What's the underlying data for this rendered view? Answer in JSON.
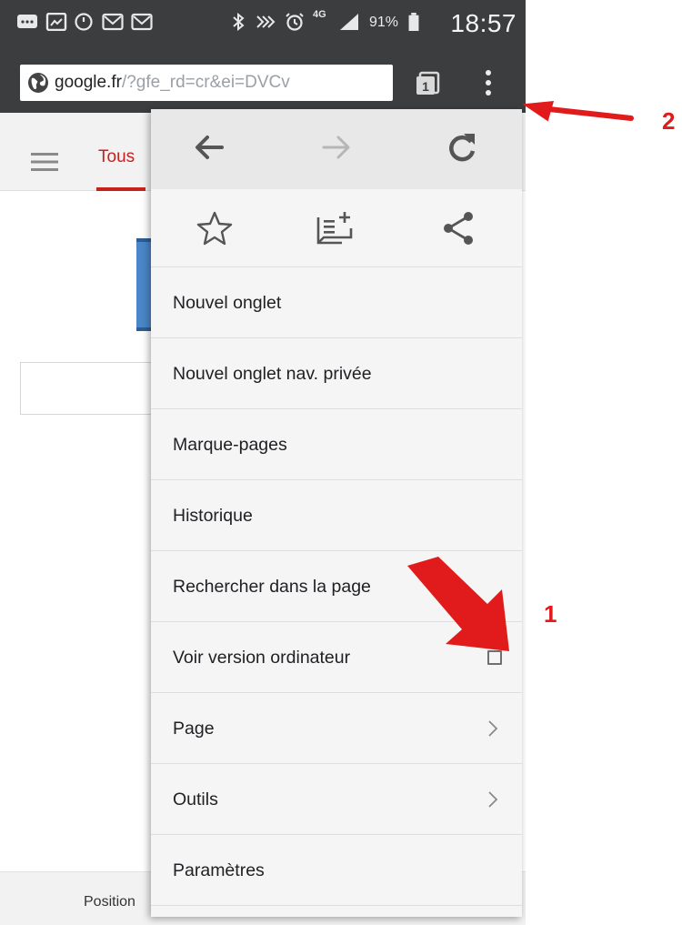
{
  "status_bar": {
    "network": "4G",
    "battery_percent": "91%",
    "clock": "18:57"
  },
  "toolbar": {
    "url_host": "google.fr",
    "url_rest": "/?gfe_rd=cr&ei=DVCv",
    "tab_count": "1"
  },
  "page": {
    "tab_label": "Tous",
    "footer_text": "Position"
  },
  "menu": {
    "items": [
      {
        "label": "Nouvel onglet"
      },
      {
        "label": "Nouvel onglet nav. privée"
      },
      {
        "label": "Marque-pages"
      },
      {
        "label": "Historique"
      },
      {
        "label": "Rechercher dans la page"
      },
      {
        "label": "Voir version ordinateur",
        "checked": false
      },
      {
        "label": "Page"
      },
      {
        "label": "Outils"
      },
      {
        "label": "Paramètres"
      }
    ]
  },
  "annotations": {
    "label_1": "1",
    "label_2": "2",
    "color": "#e11b1b"
  },
  "colors": {
    "chrome_dark": "#3b3d3f",
    "accent_red": "#c5221f",
    "menu_bg": "#f5f5f5"
  }
}
